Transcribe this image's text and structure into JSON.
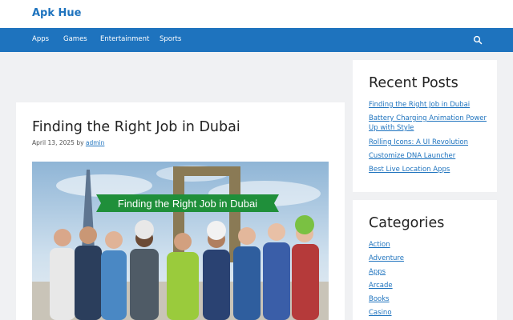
{
  "site": {
    "title": "Apk Hue"
  },
  "nav": {
    "items": [
      "Apps",
      "Games",
      "Entertainment",
      "Sports"
    ],
    "search_icon": "search-icon"
  },
  "article": {
    "title": "Finding the Right Job in Dubai",
    "date": "April 13, 2025",
    "by": "by",
    "author": "admin",
    "banner_text": "Finding the Right Job in Dubai"
  },
  "recent_posts": {
    "title": "Recent Posts",
    "items": [
      "Finding the Right Job in Dubai",
      "Battery Charging Animation Power Up with Style",
      "Rolling Icons: A UI Revolution",
      "Customize DNA Launcher",
      "Best Live Location Apps"
    ]
  },
  "categories": {
    "title": "Categories",
    "items": [
      "Action",
      "Adventure",
      "Apps",
      "Arcade",
      "Books",
      "Casino"
    ]
  },
  "colors": {
    "brand": "#1e73be",
    "page_bg": "#f0f1f3",
    "banner_green": "#1f8f3a"
  }
}
